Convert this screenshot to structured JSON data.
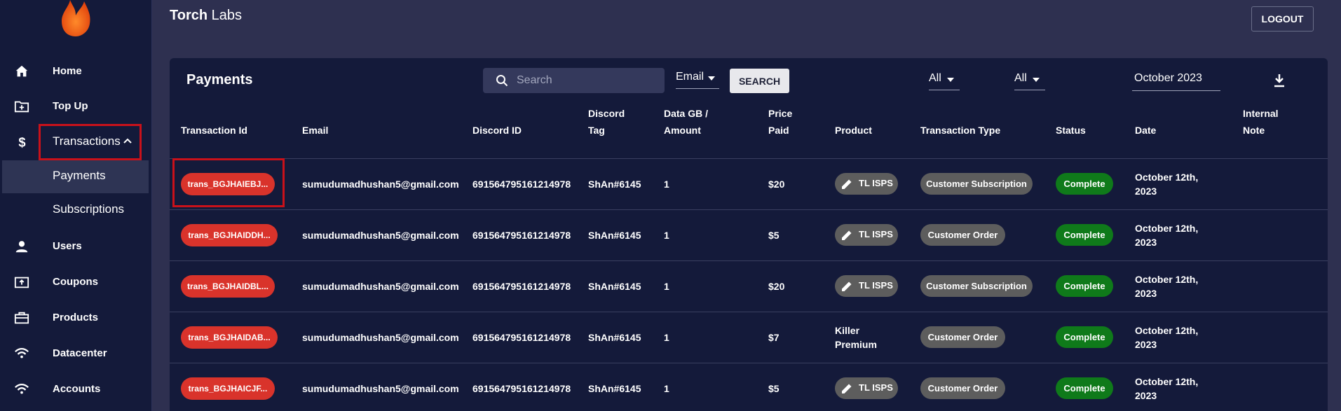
{
  "brand": {
    "bold": "Torch",
    "rest": " Labs"
  },
  "header": {
    "logout_label": "LOGOUT"
  },
  "sidebar": {
    "items": [
      {
        "label": "Home",
        "icon": "home-icon"
      },
      {
        "label": "Top Up",
        "icon": "folder-plus-icon"
      },
      {
        "label": "Transactions",
        "icon": "dollar-icon"
      },
      {
        "label": "Users",
        "icon": "user-icon"
      },
      {
        "label": "Coupons",
        "icon": "coupon-icon"
      },
      {
        "label": "Products",
        "icon": "briefcase-icon"
      },
      {
        "label": "Datacenter",
        "icon": "wifi-icon"
      },
      {
        "label": "Accounts",
        "icon": "wifi-icon"
      }
    ],
    "sub_items": [
      {
        "label": "Payments",
        "active": true
      },
      {
        "label": "Subscriptions",
        "active": false
      }
    ]
  },
  "card": {
    "title": "Payments",
    "search_placeholder": "Search",
    "search_field": "Email",
    "search_button": "SEARCH",
    "filter1": "All",
    "filter2": "All",
    "date": "October 2023"
  },
  "table": {
    "headers": {
      "tx_id": "Transaction Id",
      "email": "Email",
      "discord_id": "Discord ID",
      "discord_tag_1": "Discord",
      "discord_tag_2": "Tag",
      "data_1": "Data GB /",
      "data_2": "Amount",
      "price_1": "Price",
      "price_2": "Paid",
      "product": "Product",
      "type": "Transaction Type",
      "status": "Status",
      "date": "Date",
      "note_1": "Internal",
      "note_2": "Note"
    },
    "rows": [
      {
        "tx": "trans_BGJHAIEBJ...",
        "email": "sumudumadhushan5@gmail.com",
        "discord_id": "691564795161214978",
        "tag": "ShAn#6145",
        "amount": "1",
        "price": "$20",
        "product": "TL ISPS",
        "product_pill": true,
        "type": "Customer Subscription",
        "status": "Complete",
        "date_1": "October 12th,",
        "date_2": "2023"
      },
      {
        "tx": "trans_BGJHAIDDH...",
        "email": "sumudumadhushan5@gmail.com",
        "discord_id": "691564795161214978",
        "tag": "ShAn#6145",
        "amount": "1",
        "price": "$5",
        "product": "TL ISPS",
        "product_pill": true,
        "type": "Customer Order",
        "status": "Complete",
        "date_1": "October 12th,",
        "date_2": "2023"
      },
      {
        "tx": "trans_BGJHAIDBL...",
        "email": "sumudumadhushan5@gmail.com",
        "discord_id": "691564795161214978",
        "tag": "ShAn#6145",
        "amount": "1",
        "price": "$20",
        "product": "TL ISPS",
        "product_pill": true,
        "type": "Customer Subscription",
        "status": "Complete",
        "date_1": "October 12th,",
        "date_2": "2023"
      },
      {
        "tx": "trans_BGJHAIDAB...",
        "email": "sumudumadhushan5@gmail.com",
        "discord_id": "691564795161214978",
        "tag": "ShAn#6145",
        "amount": "1",
        "price": "$7",
        "product_1": "Killer",
        "product_2": "Premium",
        "product_pill": false,
        "type": "Customer Order",
        "status": "Complete",
        "date_1": "October 12th,",
        "date_2": "2023"
      },
      {
        "tx": "trans_BGJHAICJF...",
        "email": "sumudumadhushan5@gmail.com",
        "discord_id": "691564795161214978",
        "tag": "ShAn#6145",
        "amount": "1",
        "price": "$5",
        "product": "TL ISPS",
        "product_pill": true,
        "type": "Customer Order",
        "status": "Complete",
        "date_1": "October 12th,",
        "date_2": "2023"
      }
    ]
  },
  "colors": {
    "sidebar_bg": "#141a3a",
    "page_bg": "#2e3050",
    "tx_pill": "#d9332b",
    "status_complete": "#0f7a1a",
    "pill_grey": "#5d5d5d",
    "highlight": "#c9111a"
  }
}
